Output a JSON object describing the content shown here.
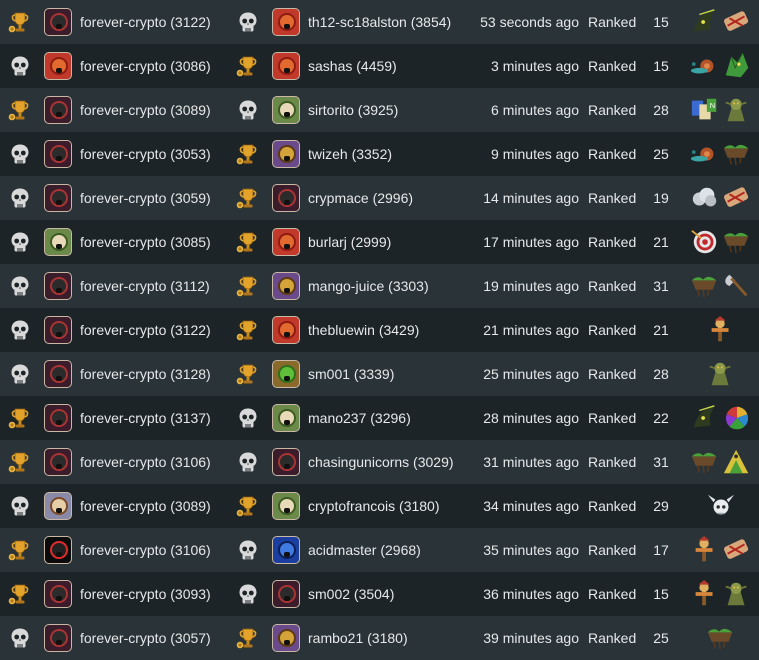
{
  "colors": {
    "row_odd": "#2a3338",
    "row_even": "#1c2428",
    "text": "#e6e8e9",
    "trophy": "#e0a12c",
    "skull": "#d8d8d8"
  },
  "battles": [
    {
      "p1_result": "win",
      "p1_avatar": "dark-monster",
      "p1_name": "forever-crypto (3122)",
      "p2_result": "loss",
      "p2_avatar": "red-dragon",
      "p2_name": "th12-sc18alston (3854)",
      "time": "53 seconds ago",
      "type": "Ranked",
      "turns": "15",
      "cards": [
        "dark-creature-card",
        "bandage-card"
      ]
    },
    {
      "p1_result": "loss",
      "p1_avatar": "red-dragon",
      "p1_name": "forever-crypto (3086)",
      "p2_result": "win",
      "p2_avatar": "red-dragon",
      "p2_name": "sashas (4459)",
      "time": "3 minutes ago",
      "type": "Ranked",
      "turns": "15",
      "cards": [
        "snail-card",
        "green-dragon-card"
      ]
    },
    {
      "p1_result": "win",
      "p1_avatar": "dark-monster",
      "p1_name": "forever-crypto (3089)",
      "p2_result": "loss",
      "p2_avatar": "elf-portrait",
      "p2_name": "sirtorito (3925)",
      "time": "6 minutes ago",
      "type": "Ranked",
      "turns": "28",
      "cards": [
        "scroll-card",
        "goblin-card"
      ]
    },
    {
      "p1_result": "loss",
      "p1_avatar": "dark-monster",
      "p1_name": "forever-crypto (3053)",
      "p2_result": "win",
      "p2_avatar": "golden-warrior",
      "p2_name": "twizeh (3352)",
      "time": "9 minutes ago",
      "type": "Ranked",
      "turns": "25",
      "cards": [
        "snail-card",
        "earth-island-card"
      ]
    },
    {
      "p1_result": "loss",
      "p1_avatar": "dark-monster",
      "p1_name": "forever-crypto (3059)",
      "p2_result": "win",
      "p2_avatar": "dark-monster",
      "p2_name": "crypmace (2996)",
      "time": "14 minutes ago",
      "type": "Ranked",
      "turns": "19",
      "cards": [
        "cloud-card",
        "bandage-card"
      ]
    },
    {
      "p1_result": "loss",
      "p1_avatar": "elf-portrait",
      "p1_name": "forever-crypto (3085)",
      "p2_result": "win",
      "p2_avatar": "red-dragon",
      "p2_name": "burlarj (2999)",
      "time": "17 minutes ago",
      "type": "Ranked",
      "turns": "21",
      "cards": [
        "target-card",
        "earth-island-card"
      ]
    },
    {
      "p1_result": "loss",
      "p1_avatar": "dark-monster",
      "p1_name": "forever-crypto (3112)",
      "p2_result": "win",
      "p2_avatar": "golden-warrior",
      "p2_name": "mango-juice (3303)",
      "time": "19 minutes ago",
      "type": "Ranked",
      "turns": "31",
      "cards": [
        "earth-island-card",
        "axe-card"
      ]
    },
    {
      "p1_result": "loss",
      "p1_avatar": "dark-monster",
      "p1_name": "forever-crypto (3122)",
      "p2_result": "win",
      "p2_avatar": "red-dragon",
      "p2_name": "thebluewin (3429)",
      "time": "21 minutes ago",
      "type": "Ranked",
      "turns": "21",
      "cards": [
        "scarecrow-card"
      ]
    },
    {
      "p1_result": "loss",
      "p1_avatar": "dark-monster",
      "p1_name": "forever-crypto (3128)",
      "p2_result": "win",
      "p2_avatar": "green-frog",
      "p2_name": "sm001 (3339)",
      "time": "25 minutes ago",
      "type": "Ranked",
      "turns": "28",
      "cards": [
        "goblin-card"
      ]
    },
    {
      "p1_result": "win",
      "p1_avatar": "dark-monster",
      "p1_name": "forever-crypto (3137)",
      "p2_result": "loss",
      "p2_avatar": "elf-portrait",
      "p2_name": "mano237 (3296)",
      "time": "28 minutes ago",
      "type": "Ranked",
      "turns": "22",
      "cards": [
        "dark-creature-card",
        "color-wheel-card"
      ]
    },
    {
      "p1_result": "win",
      "p1_avatar": "dark-monster",
      "p1_name": "forever-crypto (3106)",
      "p2_result": "loss",
      "p2_avatar": "dark-monster",
      "p2_name": "chasingunicorns (3029)",
      "time": "31 minutes ago",
      "type": "Ranked",
      "turns": "31",
      "cards": [
        "earth-island-card",
        "mountain-eye-card"
      ]
    },
    {
      "p1_result": "loss",
      "p1_avatar": "elf-warrior",
      "p1_name": "forever-crypto (3089)",
      "p2_result": "win",
      "p2_avatar": "elf-portrait",
      "p2_name": "cryptofrancois (3180)",
      "time": "34 minutes ago",
      "type": "Ranked",
      "turns": "29",
      "cards": [
        "horned-skull-card"
      ]
    },
    {
      "p1_result": "win",
      "p1_avatar": "black-fang",
      "p1_name": "forever-crypto (3106)",
      "p2_result": "loss",
      "p2_avatar": "blue-mage",
      "p2_name": "acidmaster (2968)",
      "time": "35 minutes ago",
      "type": "Ranked",
      "turns": "17",
      "cards": [
        "scarecrow-card",
        "bandage-card"
      ]
    },
    {
      "p1_result": "win",
      "p1_avatar": "dark-monster",
      "p1_name": "forever-crypto (3093)",
      "p2_result": "loss",
      "p2_avatar": "dark-monster",
      "p2_name": "sm002 (3504)",
      "time": "36 minutes ago",
      "type": "Ranked",
      "turns": "15",
      "cards": [
        "scarecrow-card",
        "goblin-card"
      ]
    },
    {
      "p1_result": "loss",
      "p1_avatar": "dark-monster",
      "p1_name": "forever-crypto (3057)",
      "p2_result": "win",
      "p2_avatar": "golden-warrior",
      "p2_name": "rambo21 (3180)",
      "time": "39 minutes ago",
      "type": "Ranked",
      "turns": "25",
      "cards": [
        "earth-island-card"
      ]
    }
  ]
}
